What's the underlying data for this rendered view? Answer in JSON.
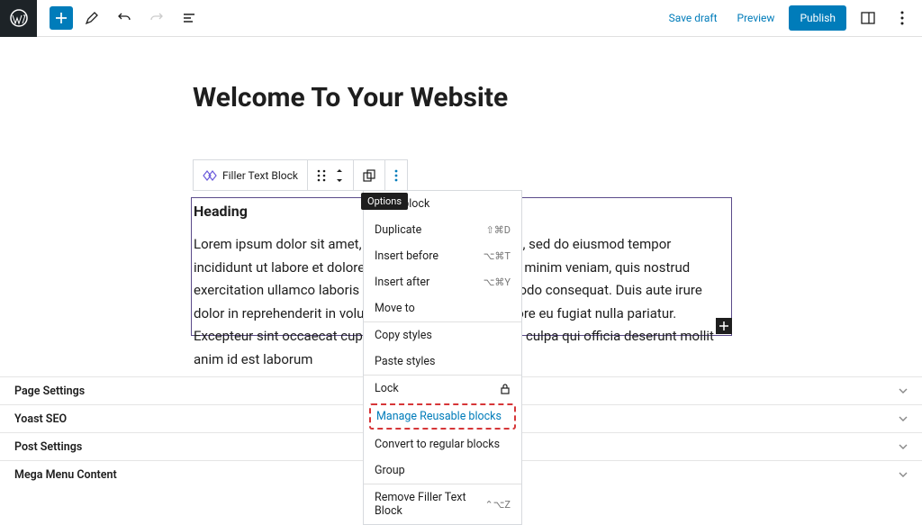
{
  "topbar": {
    "save_draft": "Save draft",
    "preview": "Preview",
    "publish": "Publish"
  },
  "post": {
    "title": "Welcome To Your Website",
    "heading": "Heading",
    "body": "Lorem ipsum dolor sit amet, consectetur adipiscing elit, sed do eiusmod tempor incididunt ut labore et dolore magna aliqua. Ut enim ad minim veniam, quis nostrud exercitation ullamco laboris nisi ut aliquip ex ea commodo consequat. Duis aute irure dolor in reprehenderit in voluptate velit esse cillum dolore eu fugiat nulla pariatur. Excepteur sint occaecat cupidatat non proident, sunt in culpa qui officia deserunt mollit anim id est laborum"
  },
  "block_toolbar": {
    "block_name": "Filler Text Block",
    "tooltip": "Options"
  },
  "options_menu": {
    "copy_block": "Copy block",
    "duplicate": "Duplicate",
    "duplicate_shortcut": "⇧⌘D",
    "insert_before": "Insert before",
    "insert_before_shortcut": "⌥⌘T",
    "insert_after": "Insert after",
    "insert_after_shortcut": "⌥⌘Y",
    "move_to": "Move to",
    "copy_styles": "Copy styles",
    "paste_styles": "Paste styles",
    "lock": "Lock",
    "manage_reusable": "Manage Reusable blocks",
    "convert": "Convert to regular blocks",
    "group": "Group",
    "remove": "Remove Filler Text Block",
    "remove_shortcut": "⌃⌥Z"
  },
  "panels": {
    "page_settings": "Page Settings",
    "yoast_seo": "Yoast SEO",
    "post_settings": "Post Settings",
    "mega_menu": "Mega Menu Content"
  }
}
